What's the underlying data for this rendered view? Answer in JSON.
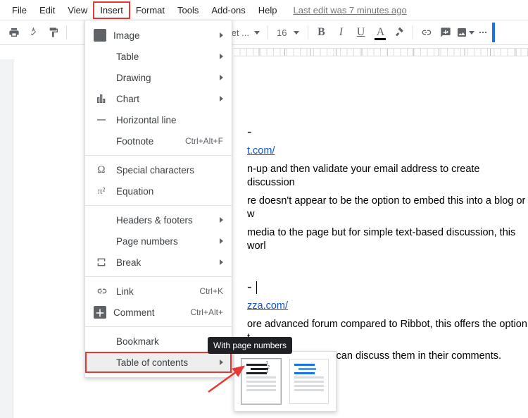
{
  "menubar": {
    "items": [
      "File",
      "Edit",
      "View",
      "Insert",
      "Format",
      "Tools",
      "Add-ons",
      "Help"
    ],
    "active_index": 3,
    "last_edit": "Last edit was 7 minutes ago"
  },
  "toolbar": {
    "font_name_fragment": "chet ...",
    "font_size": "16"
  },
  "dropdown": {
    "items": [
      {
        "label": "Image",
        "icon": "image-icon",
        "submenu": true
      },
      {
        "label": "Table",
        "submenu": true
      },
      {
        "label": "Drawing",
        "submenu": true
      },
      {
        "label": "Chart",
        "icon": "chart-icon",
        "submenu": true
      },
      {
        "label": "Horizontal line",
        "icon": "hline-icon"
      },
      {
        "label": "Footnote",
        "shortcut": "Ctrl+Alt+F"
      },
      {
        "sep": true
      },
      {
        "label": "Special characters",
        "icon": "omega-icon"
      },
      {
        "label": "Equation",
        "icon": "pi-icon"
      },
      {
        "sep": true
      },
      {
        "label": "Headers & footers",
        "submenu": true
      },
      {
        "label": "Page numbers",
        "submenu": true
      },
      {
        "label": "Break",
        "icon": "break-icon",
        "submenu": true
      },
      {
        "sep": true
      },
      {
        "label": "Link",
        "icon": "link-icon",
        "shortcut": "Ctrl+K"
      },
      {
        "label": "Comment",
        "icon": "comment-icon",
        "shortcut": "Ctrl+Alt+"
      },
      {
        "sep": true
      },
      {
        "label": "Bookmark"
      },
      {
        "label": "Table of contents",
        "submenu": true,
        "highlighted": true
      }
    ]
  },
  "tooltip": "With page numbers",
  "doc": {
    "heading1_suffix": "-",
    "link1_fragment": "t.com/",
    "para1_line1": "n-up and then validate your email address to create discussion",
    "para1_line2": "re doesn't appear to be the option to embed this into a blog or w",
    "para1_line3": "media to the page but for simple text-based discussion, this worl",
    "heading2_suffix": "-",
    "link2_fragment": "zza.com/",
    "para2_line1": "ore advanced forum compared to Ribbot, this offers the option t",
    "para2_line2": "so that the children can discuss them in their comments."
  }
}
